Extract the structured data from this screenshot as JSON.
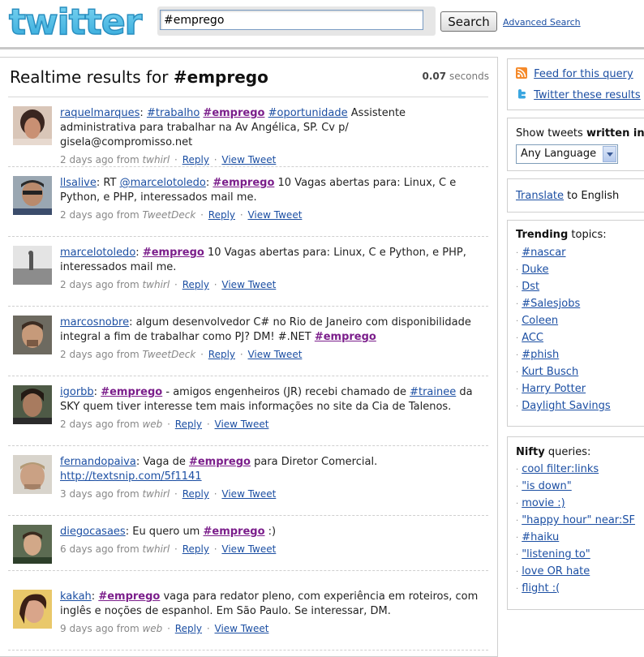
{
  "header": {
    "logo_text": "twitter",
    "search_value": "#emprego",
    "search_button": "Search",
    "advanced_search": "Advanced Search"
  },
  "results": {
    "title_prefix": "Realtime results for",
    "query": "#emprego",
    "time_value": "0.07",
    "time_unit": "seconds"
  },
  "tweets": [
    {
      "user": "raquelmarques",
      "sep": ":",
      "parts": [
        " ",
        "#trabalho",
        " ",
        "#emprego",
        " ",
        "#oportunidade",
        " Assistente administrativa para trabalhar na Av Angélica, SP. Cv p/ gisela@compromisso.net"
      ],
      "age": "2 days ago from",
      "source": "twhirl",
      "reply": "Reply",
      "view": "View Tweet"
    },
    {
      "user": "llsalive",
      "sep": ":",
      "pre": " RT ",
      "mention": "@marcelotoledo",
      "mid": ": ",
      "tag": "#emprego",
      "post": " 10 Vagas abertas para: Linux, C e Python, e PHP, interessados mail me.",
      "age": "2 days ago from",
      "source": "TweetDeck",
      "reply": "Reply",
      "view": "View Tweet"
    },
    {
      "user": "marcelotoledo",
      "sep": ":",
      "tag": "#emprego",
      "post": " 10 Vagas abertas para: Linux, C e Python, e PHP, interessados mail me.",
      "age": "2 days ago from",
      "source": "twhirl",
      "reply": "Reply",
      "view": "View Tweet"
    },
    {
      "user": "marcosnobre",
      "sep": ":",
      "pre": " algum desenvolvedor C# no Rio de Janeiro com disponibilidade integral a fim de trabalhar como PJ? DM! #.NET ",
      "tag": "#emprego",
      "age": "2 days ago from",
      "source": "TweetDeck",
      "reply": "Reply",
      "view": "View Tweet"
    },
    {
      "user": "igorbb",
      "sep": ":",
      "tag": "#emprego",
      "mid": " - amigos engenheiros (JR) recebi chamado de ",
      "tag2": "#trainee",
      "post": " da SKY quem tiver interesse tem mais informações no site da Cia de Talenos.",
      "age": "2 days ago from",
      "source": "web",
      "reply": "Reply",
      "view": "View Tweet"
    },
    {
      "user": "fernandopaiva",
      "sep": ":",
      "pre": " Vaga de ",
      "tag": "#emprego",
      "post": " para Diretor Comercial.",
      "link": "http://textsnip.com/5f1141",
      "age": "3 days ago from",
      "source": "twhirl",
      "reply": "Reply",
      "view": "View Tweet"
    },
    {
      "user": "diegocasaes",
      "sep": ":",
      "pre": " Eu quero um ",
      "tag": "#emprego",
      "post": " :)",
      "age": "6 days ago from",
      "source": "twhirl",
      "reply": "Reply",
      "view": "View Tweet"
    },
    {
      "user": "kakah",
      "sep": ":",
      "tag": "#emprego",
      "post": " vaga para redator pleno, com experiência em roteiros, com inglês e noções de espanhol. Em São Paulo. Se interessar, DM.",
      "age": "9 days ago from",
      "source": "web",
      "reply": "Reply",
      "view": "View Tweet"
    }
  ],
  "sidebar": {
    "feed_link": "Feed for this query",
    "twitter_results_link": "Twitter these results",
    "show_tweets_prefix": "Show tweets",
    "show_tweets_bold": "written in",
    "show_tweets_suffix": ":",
    "language_selected": "Any Language",
    "translate_link": "Translate",
    "translate_suffix": "to English",
    "trending_bold": "Trending",
    "trending_suffix": "topics:",
    "trending": [
      "#nascar",
      "Duke",
      "Dst",
      "#Salesjobs",
      "Coleen",
      "ACC",
      "#phish",
      "Kurt Busch",
      "Harry Potter",
      "Daylight Savings"
    ],
    "nifty_bold": "Nifty",
    "nifty_suffix": "queries:",
    "nifty": [
      "cool filter:links",
      "\"is down\"",
      "movie :)",
      "\"happy hour\" near:SF",
      "#haiku",
      "\"listening to\"",
      "love OR hate",
      "flight :("
    ]
  },
  "colors": {
    "link": "#1c4fa3",
    "hashtag": "#7b1e8b",
    "logo": "#5ec3e8"
  }
}
